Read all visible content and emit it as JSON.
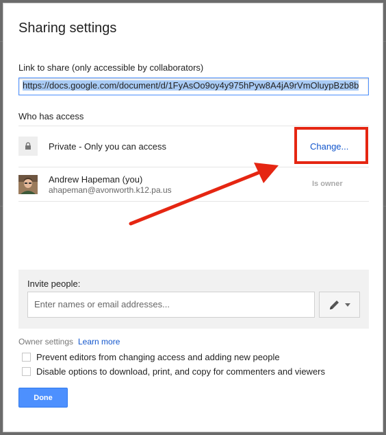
{
  "dialog": {
    "title": "Sharing settings",
    "link_label": "Link to share (only accessible by collaborators)",
    "link_value": "https://docs.google.com/document/d/1FyAsOo9oy4y975hPyw8A4jA9rVmOluypBzb8b",
    "who_has_access_label": "Who has access",
    "access": {
      "text": "Private - Only you can access",
      "change_label": "Change..."
    },
    "owner": {
      "name": "Andrew Hapeman (you)",
      "email": "ahapeman@avonworth.k12.pa.us",
      "role": "Is owner"
    },
    "invite": {
      "label": "Invite people:",
      "placeholder": "Enter names or email addresses...",
      "permission_icon": "pencil-icon"
    },
    "owner_settings": {
      "label": "Owner settings",
      "learn_more": "Learn more",
      "options": [
        "Prevent editors from changing access and adding new people",
        "Disable options to download, print, and copy for commenters and viewers"
      ]
    },
    "done_label": "Done"
  },
  "colors": {
    "accent": "#4d90fe",
    "link": "#1155cc",
    "annotation": "#e52612"
  }
}
